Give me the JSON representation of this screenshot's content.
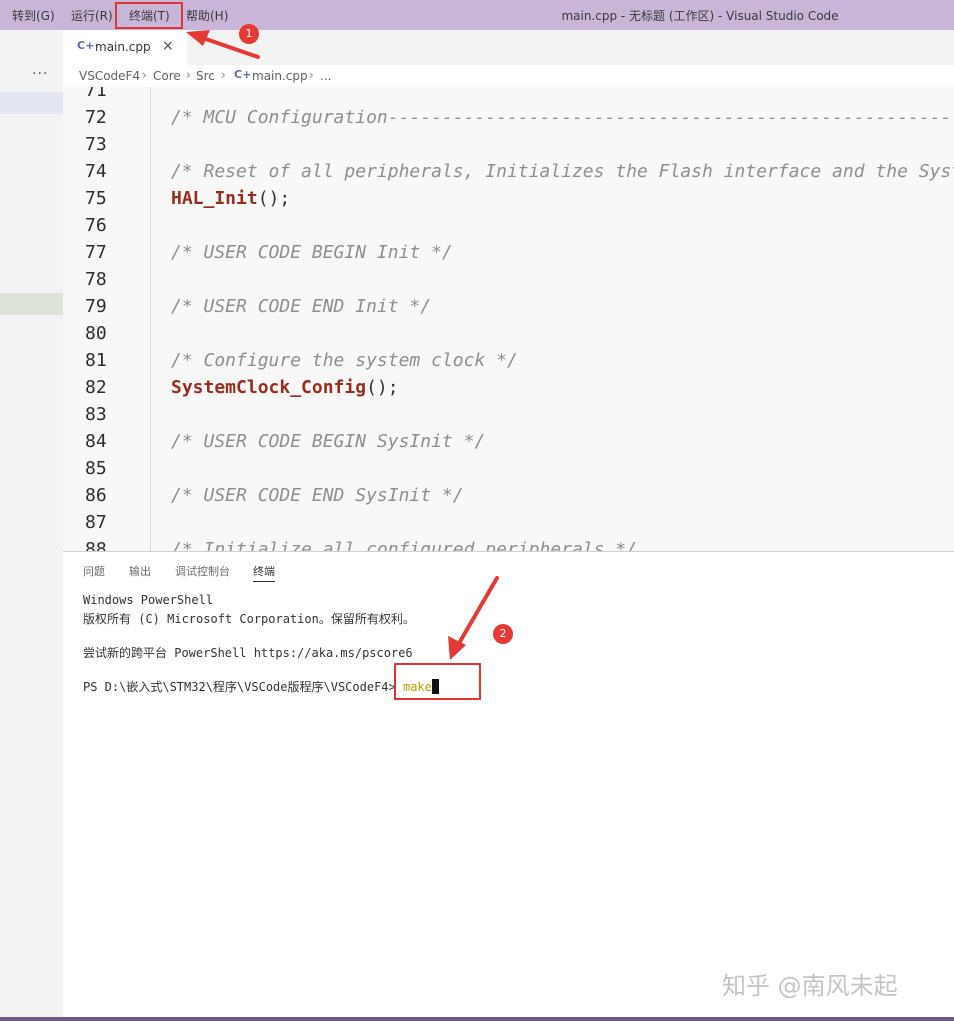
{
  "menubar": {
    "items": [
      "转到(G)",
      "运行(R)",
      "终端(T)",
      "帮助(H)"
    ],
    "window_title": "main.cpp - 无标题 (工作区) - Visual Studio Code"
  },
  "sidebar": {
    "more": "···"
  },
  "tab": {
    "label": "main.cpp",
    "icon": "cpp-file-icon",
    "close": "×"
  },
  "breadcrumb": {
    "items": [
      "VSCodeF4",
      "Core",
      "Src",
      "main.cpp",
      "..."
    ]
  },
  "editor": {
    "lines": [
      {
        "n": "71",
        "text": "",
        "kind": "blank"
      },
      {
        "n": "72",
        "text": "/* MCU Configuration--------------------------------------------------------*/",
        "kind": "comment"
      },
      {
        "n": "73",
        "text": "",
        "kind": "blank"
      },
      {
        "n": "74",
        "text": "/* Reset of all peripherals, Initializes the Flash interface and the Systick. */",
        "kind": "comment"
      },
      {
        "n": "75",
        "fn": "HAL_Init",
        "rest": "();",
        "kind": "call"
      },
      {
        "n": "76",
        "text": "",
        "kind": "blank"
      },
      {
        "n": "77",
        "text": "/* USER CODE BEGIN Init */",
        "kind": "comment"
      },
      {
        "n": "78",
        "text": "",
        "kind": "blank"
      },
      {
        "n": "79",
        "text": "/* USER CODE END Init */",
        "kind": "comment"
      },
      {
        "n": "80",
        "text": "",
        "kind": "blank"
      },
      {
        "n": "81",
        "text": "/* Configure the system clock */",
        "kind": "comment"
      },
      {
        "n": "82",
        "fn": "SystemClock_Config",
        "rest": "();",
        "kind": "call"
      },
      {
        "n": "83",
        "text": "",
        "kind": "blank"
      },
      {
        "n": "84",
        "text": "/* USER CODE BEGIN SysInit */",
        "kind": "comment"
      },
      {
        "n": "85",
        "text": "",
        "kind": "blank"
      },
      {
        "n": "86",
        "text": "/* USER CODE END SysInit */",
        "kind": "comment"
      },
      {
        "n": "87",
        "text": "",
        "kind": "blank"
      },
      {
        "n": "88",
        "text": "/* Initialize all configured peripherals */",
        "kind": "comment"
      }
    ]
  },
  "panel": {
    "tabs": [
      "问题",
      "输出",
      "调试控制台",
      "终端"
    ],
    "active_tab": "终端",
    "terminal": {
      "lines": [
        "Windows PowerShell",
        "版权所有 (C) Microsoft Corporation。保留所有权利。",
        "",
        "尝试新的跨平台 PowerShell https://aka.ms/pscore6",
        ""
      ],
      "prompt": "PS D:\\嵌入式\\STM32\\程序\\VSCode版程序\\VSCodeF4> ",
      "command": "make"
    }
  },
  "annotations": {
    "badge1": "1",
    "badge2": "2"
  },
  "watermark": "知乎 @南风未起",
  "colors": {
    "titlebar": "#c9b5d8",
    "annotation": "#e53935",
    "function": "#9b2a1f",
    "comment": "#8e8e8e"
  }
}
